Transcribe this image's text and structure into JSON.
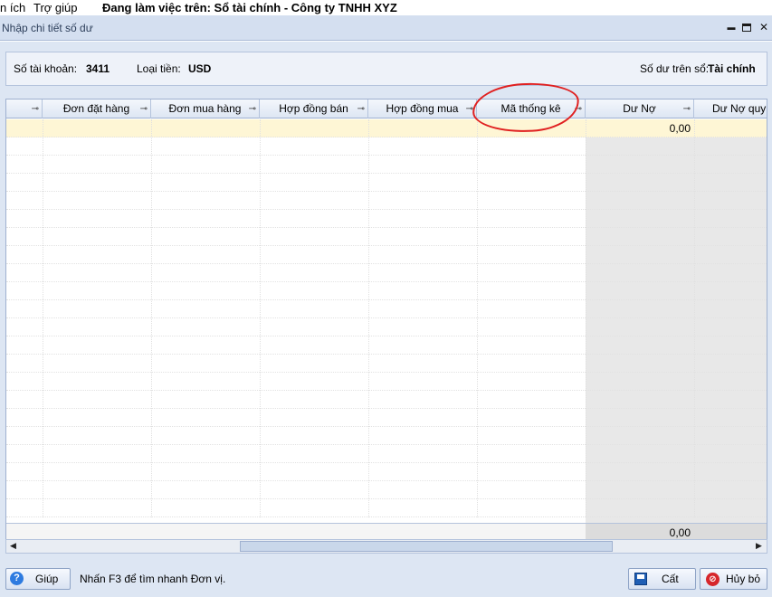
{
  "menu": {
    "items": [
      "n ích",
      "Trợ giúp"
    ],
    "working_on": "Đang làm việc trên: Sổ tài chính - Công ty TNHH XYZ"
  },
  "window": {
    "title": "Nhập chi tiết số dư",
    "minimize_glyph": "▬",
    "close_glyph": "✕"
  },
  "info": {
    "account_label": "Số tài khoản:",
    "account_value": "3411",
    "currency_label": "Loại tiền:",
    "currency_value": "USD",
    "ledger_label": "Số dư trên sổ:",
    "ledger_value": "Tài chính"
  },
  "grid": {
    "columns": [
      "",
      "Đơn đặt hàng",
      "Đơn mua hàng",
      "Hợp đồng bán",
      "Hợp đồng mua",
      "Mã thống kê",
      "Dư Nợ",
      "Dư Nợ quy đ"
    ],
    "pin_glyph": "⊸",
    "first_row_debit": "0,00",
    "total_debit": "0,00",
    "row_count": 22
  },
  "scroll": {
    "left_glyph": "◀",
    "right_glyph": "▶"
  },
  "footer": {
    "help_label": "Giúp",
    "hint": "Nhấn F3 để tìm nhanh Đơn vị.",
    "save_label": "Cất",
    "cancel_label": "Hủy bỏ"
  },
  "colors": {
    "selected_row": "#fef6d5",
    "annotation": "#e02020",
    "header_bg": "#dde6f3"
  }
}
